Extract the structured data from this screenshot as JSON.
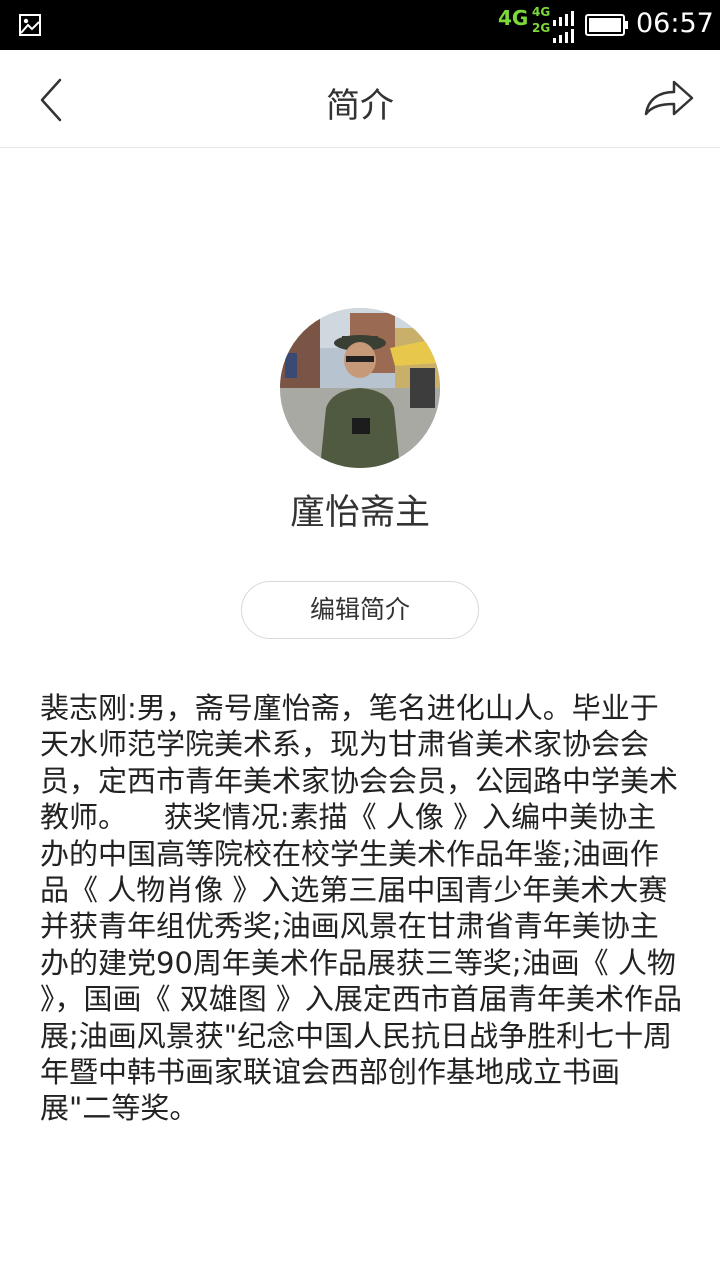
{
  "status_bar": {
    "network": "4G",
    "network_secondary_top": "4G",
    "network_secondary_bottom": "2G",
    "time": "06:57",
    "left_icon": "image-notification-icon",
    "signal_icon": "signal-icon",
    "battery_icon": "battery-icon",
    "accent_color": "#7dd93a"
  },
  "header": {
    "title": "简介",
    "back_icon": "chevron-left-icon",
    "share_icon": "share-arrow-icon"
  },
  "profile": {
    "name": "廑怡斋主",
    "edit_button_label": "编辑简介"
  },
  "bio": {
    "text": "裴志刚:男，斋号廑怡斋，笔名进化山人。毕业于天水师范学院美术系，现为甘肃省美术家协会会员，定西市青年美术家协会会员，公园路中学美术教师。    获奖情况:素描《 人像 》入编中美协主办的中国高等院校在校学生美术作品年鉴;油画作品《 人物肖像 》入选第三届中国青少年美术大赛并获青年组优秀奖;油画风景在甘肃省青年美协主办的建党90周年美术作品展获三等奖;油画《 人物 》，国画《 双雄图 》入展定西市首届青年美术作品展;油画风景获\"纪念中国人民抗日战争胜利七十周年暨中韩书画家联谊会西部创作基地成立书画展\"二等奖。"
  }
}
